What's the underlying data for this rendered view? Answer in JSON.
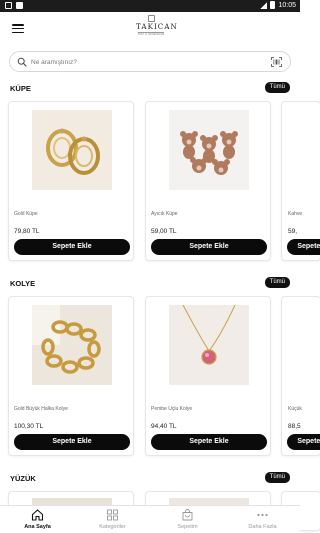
{
  "status_bar": {
    "time": "10:05"
  },
  "header": {
    "brand_name": "TAKICAN",
    "brand_sub": "TAKI & AKSESUAR"
  },
  "search": {
    "placeholder": "Ne aramıştınız?"
  },
  "sections": [
    {
      "title": "KÜPE",
      "see_all": "Tümü",
      "products": [
        {
          "name": "Gold Küpe",
          "price": "79,80 TL",
          "button": "Sepete Ekle"
        },
        {
          "name": "Ayıcık Küpe",
          "price": "59,00 TL",
          "button": "Sepete Ekle"
        },
        {
          "name": "Kahve",
          "price": "59,",
          "button": "Sepete Ekle"
        }
      ]
    },
    {
      "title": "KOLYE",
      "see_all": "Tümü",
      "products": [
        {
          "name": "Gold Büyük Halka Kolye",
          "price": "100,30 TL",
          "button": "Sepete Ekle"
        },
        {
          "name": "Pembe Uçlu Kolye",
          "price": "94,40 TL",
          "button": "Sepete Ekle"
        },
        {
          "name": "Küçük",
          "price": "88,5",
          "button": "Sepete Ekle"
        }
      ]
    },
    {
      "title": "YÜZÜK",
      "see_all": "Tümü",
      "products": []
    }
  ],
  "bottom_nav": [
    {
      "label": "Ana Sayfa",
      "icon": "home-icon",
      "active": true
    },
    {
      "label": "Kategoriler",
      "icon": "grid-icon",
      "active": false
    },
    {
      "label": "Sepetim",
      "icon": "cart-icon",
      "active": false
    },
    {
      "label": "Daha Fazla",
      "icon": "more-icon",
      "active": false
    }
  ],
  "colors": {
    "button": "#0b0b0b",
    "badge": "#111111",
    "nav_inactive": "#999999",
    "nav_active": "#111111"
  }
}
